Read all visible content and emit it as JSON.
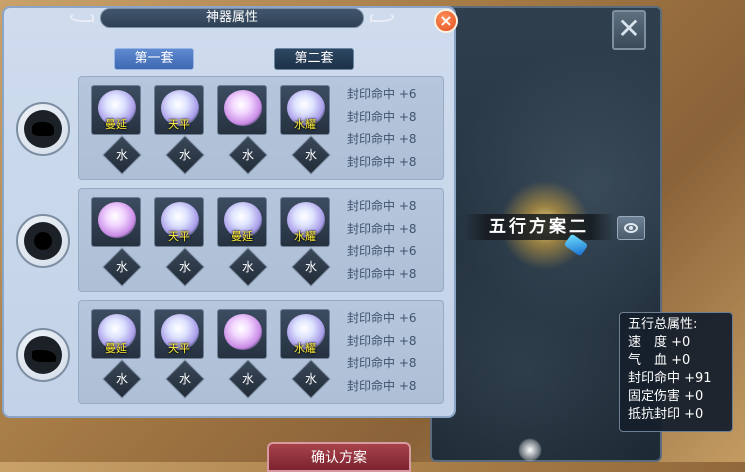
{
  "dialog": {
    "title": "神器属性",
    "close_label": "×",
    "sets": [
      {
        "label": "第一套",
        "active": false
      },
      {
        "label": "第二套",
        "active": true
      }
    ],
    "groups": [
      {
        "slot": "slot-1",
        "items": [
          {
            "tag": "曼延",
            "element": "水"
          },
          {
            "tag": "天平",
            "element": "水"
          },
          {
            "tag": "",
            "element": "水"
          },
          {
            "tag": "水耀",
            "element": "水"
          }
        ],
        "attrs": [
          "封印命中 +6",
          "封印命中 +8",
          "封印命中 +8",
          "封印命中 +8"
        ]
      },
      {
        "slot": "slot-2",
        "items": [
          {
            "tag": "",
            "element": "水"
          },
          {
            "tag": "天平",
            "element": "水"
          },
          {
            "tag": "曼延",
            "element": "水"
          },
          {
            "tag": "水耀",
            "element": "水"
          }
        ],
        "attrs": [
          "封印命中 +8",
          "封印命中 +8",
          "封印命中 +6",
          "封印命中 +8"
        ]
      },
      {
        "slot": "slot-3",
        "items": [
          {
            "tag": "曼延",
            "element": "水"
          },
          {
            "tag": "天平",
            "element": "水"
          },
          {
            "tag": "",
            "element": "水"
          },
          {
            "tag": "水耀",
            "element": "水"
          }
        ],
        "attrs": [
          "封印命中 +6",
          "封印命中 +8",
          "封印命中 +8",
          "封印命中 +8"
        ]
      }
    ]
  },
  "scheme": {
    "label": "五行方案二"
  },
  "total": {
    "title": "五行总属性:",
    "rows": [
      "速　度 +0",
      "气　血 +0",
      "封印命中 +91",
      "固定伤害 +0",
      "抵抗封印 +0"
    ]
  },
  "confirm_label": "确认方案",
  "bg_close_label": "✕",
  "colors": {
    "accent_blue": "#3e68b1",
    "tag_yellow": "#ffef3a",
    "attr_text": "#3e536e"
  }
}
